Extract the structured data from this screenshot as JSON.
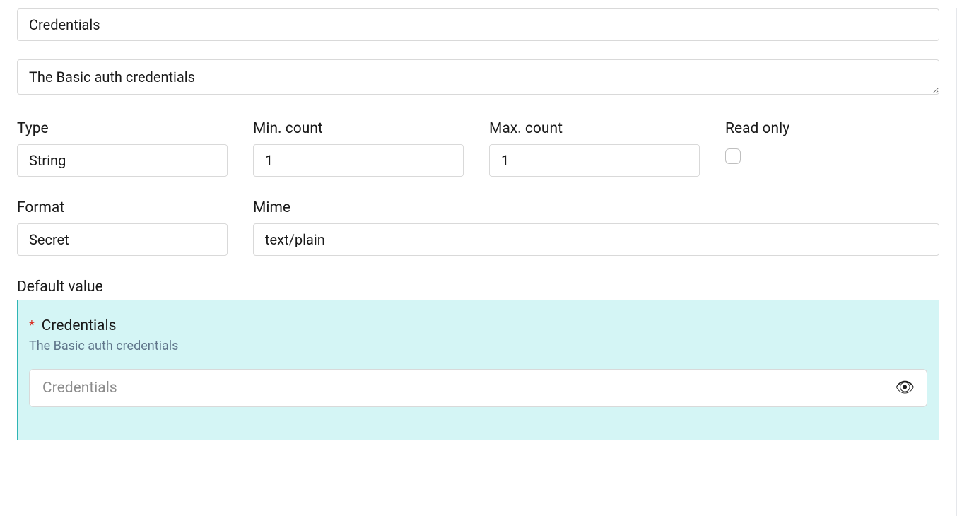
{
  "name_input": {
    "value": "Credentials"
  },
  "desc_textarea": {
    "value": "The Basic auth credentials"
  },
  "row1": {
    "type": {
      "label": "Type",
      "value": "String"
    },
    "min": {
      "label": "Min. count",
      "value": "1"
    },
    "max": {
      "label": "Max. count",
      "value": "1"
    },
    "readonly": {
      "label": "Read only",
      "checked": false
    }
  },
  "row2": {
    "format": {
      "label": "Format",
      "value": "Secret"
    },
    "mime": {
      "label": "Mime",
      "value": "text/plain"
    }
  },
  "default_value": {
    "label": "Default value",
    "title": "Credentials",
    "desc": "The Basic auth credentials",
    "placeholder": "Credentials",
    "eye_glyph": "👁"
  }
}
